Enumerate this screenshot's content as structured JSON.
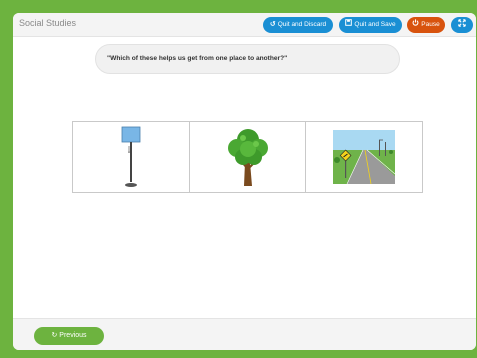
{
  "header": {
    "title": "Social Studies",
    "quit_discard_label": "Quit and Discard",
    "quit_save_label": "Quit and Save",
    "pause_label": "Pause",
    "quit_discard_icon": "undo-icon",
    "quit_save_icon": "save-icon",
    "pause_icon": "power-icon",
    "expand_icon": "expand-icon"
  },
  "question": {
    "text": "\"Which of these helps us get from one place to another?\""
  },
  "choices": [
    {
      "name": "floor-lamp-image"
    },
    {
      "name": "tree-image"
    },
    {
      "name": "road-image"
    }
  ],
  "footer": {
    "previous_label": "Previous",
    "previous_icon": "back-arrow-icon"
  },
  "colors": {
    "background": "#6db33f",
    "blue_button": "#1a8fd4",
    "orange_button": "#d8530e",
    "previous_button": "#6db33f"
  }
}
